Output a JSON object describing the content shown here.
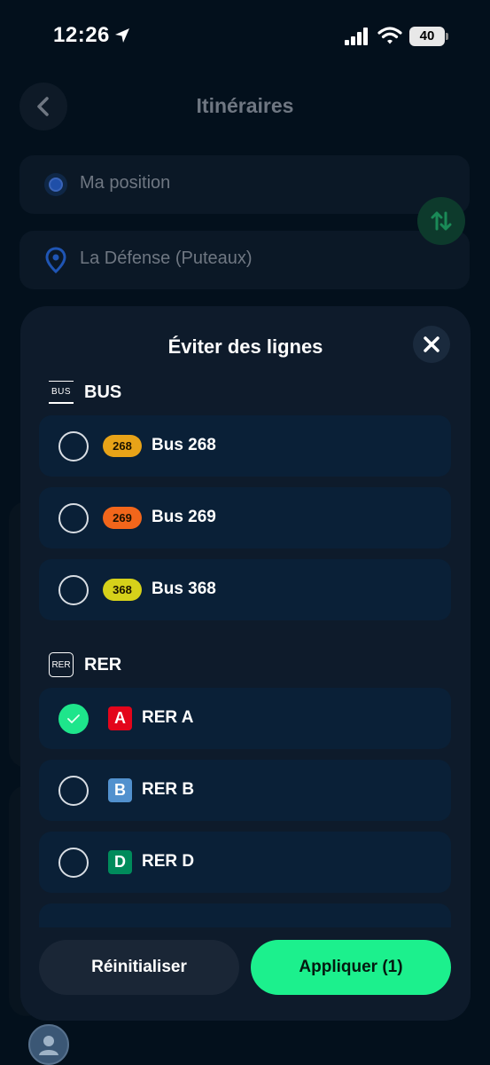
{
  "status_bar": {
    "time": "12:26",
    "battery": "40",
    "icons": [
      "location-arrow-icon",
      "cellular-signal-icon",
      "wifi-icon",
      "battery-icon"
    ]
  },
  "header": {
    "title": "Itinéraires",
    "back_icon": "chevron-left-icon"
  },
  "route": {
    "origin_placeholder": "Ma position",
    "destination_placeholder": "La Défense (Puteaux)",
    "swap_icon": "swap-vertical-icon"
  },
  "sheet": {
    "title": "Éviter des lignes",
    "close_icon": "close-icon",
    "sections": [
      {
        "icon_text": "BUS",
        "label": "BUS",
        "items": [
          {
            "badge": "268",
            "label": "Bus 268",
            "color": "#e8a318",
            "checked": false
          },
          {
            "badge": "269",
            "label": "Bus 269",
            "color": "#f2661b",
            "checked": false
          },
          {
            "badge": "368",
            "label": "Bus 368",
            "color": "#d6d11a",
            "checked": false
          }
        ]
      },
      {
        "icon_text": "RER",
        "label": "RER",
        "items": [
          {
            "badge": "A",
            "label": "RER A",
            "color": "#e3051b",
            "checked": true
          },
          {
            "badge": "B",
            "label": "RER B",
            "color": "#5291ce",
            "checked": false
          },
          {
            "badge": "D",
            "label": "RER D",
            "color": "#008b5b",
            "checked": false
          }
        ]
      }
    ],
    "buttons": {
      "reset": "Réinitialiser",
      "apply": "Appliquer (1)"
    }
  },
  "colors": {
    "accent": "#1cf08d",
    "background": "#03101c",
    "sheet": "#0e1b2b",
    "row": "#0a2037"
  }
}
